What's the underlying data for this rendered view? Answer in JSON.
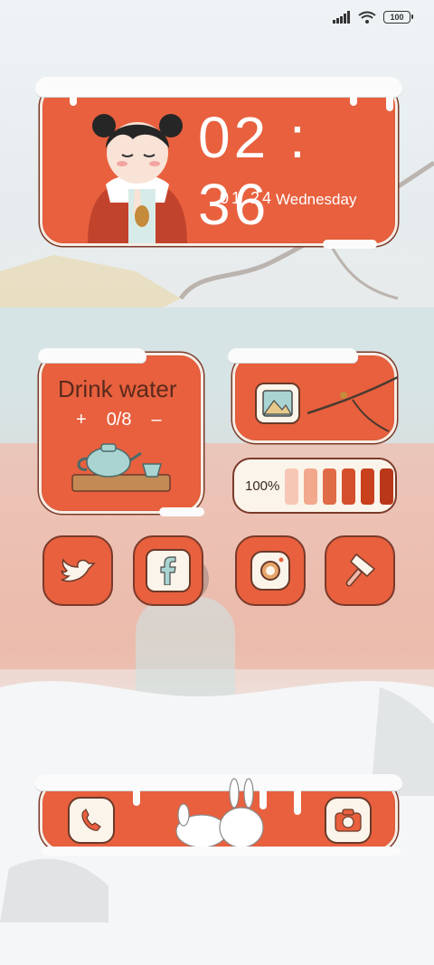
{
  "status_bar": {
    "battery_level": "100",
    "signal": "signal-icon",
    "wifi": "wifi-icon"
  },
  "clock_widget": {
    "time": "02 : 36",
    "date": "01.24",
    "weekday": "Wednesday"
  },
  "water_widget": {
    "title": "Drink water",
    "plus": "+",
    "count": "0/8",
    "minus": "–"
  },
  "photo_widget": {
    "icon": "image-icon"
  },
  "battery_widget": {
    "percent_label": "100%",
    "level": 1.0,
    "bar_colors": [
      "#f6c7b5",
      "#f2a88d",
      "#e06b47",
      "#d4502c",
      "#c8401c",
      "#b9381a"
    ]
  },
  "apps": [
    {
      "name": "twitter",
      "icon": "bird-icon"
    },
    {
      "name": "facebook",
      "icon": "facebook-icon"
    },
    {
      "name": "instagram",
      "icon": "instagram-icon"
    },
    {
      "name": "theme",
      "icon": "paintbrush-icon"
    }
  ],
  "dock": [
    {
      "name": "phone",
      "icon": "phone-icon"
    },
    {
      "name": "camera",
      "icon": "camera-icon"
    }
  ],
  "colors": {
    "accent": "#e8603e",
    "cream": "#fbf4ea",
    "outline": "#7a3a2a",
    "snow": "#fbfbfb"
  }
}
